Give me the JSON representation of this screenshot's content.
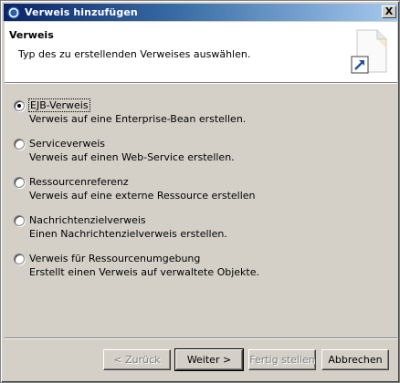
{
  "window": {
    "title": "Verweis hinzufügen",
    "close_label": "X"
  },
  "banner": {
    "title": "Verweis",
    "description": "Typ des zu erstellenden Verweises auswählen."
  },
  "options": [
    {
      "label": "EJB-Verweis",
      "description": "Verweis auf eine Enterprise-Bean erstellen.",
      "selected": true
    },
    {
      "label": "Serviceverweis",
      "description": "Verweis auf einen Web-Service erstellen.",
      "selected": false
    },
    {
      "label": "Ressourcenreferenz",
      "description": "Verweis auf eine externe Ressource erstellen",
      "selected": false
    },
    {
      "label": "Nachrichtenzielverweis",
      "description": "Einen Nachrichtenzielverweis erstellen.",
      "selected": false
    },
    {
      "label": "Verweis für Ressourcenumgebung",
      "description": "Erstellt einen Verweis auf verwaltete Objekte.",
      "selected": false
    }
  ],
  "buttons": {
    "back": "< Zurück",
    "next": "Weiter >",
    "finish": "Fertig stellen",
    "cancel": "Abbrechen"
  },
  "icons": {
    "title": "eclipse-icon",
    "banner": "wizard-page-icon"
  },
  "colors": {
    "title_start": "#0a246a",
    "title_end": "#a6caf0",
    "dialog_bg": "#d4d0c8"
  }
}
